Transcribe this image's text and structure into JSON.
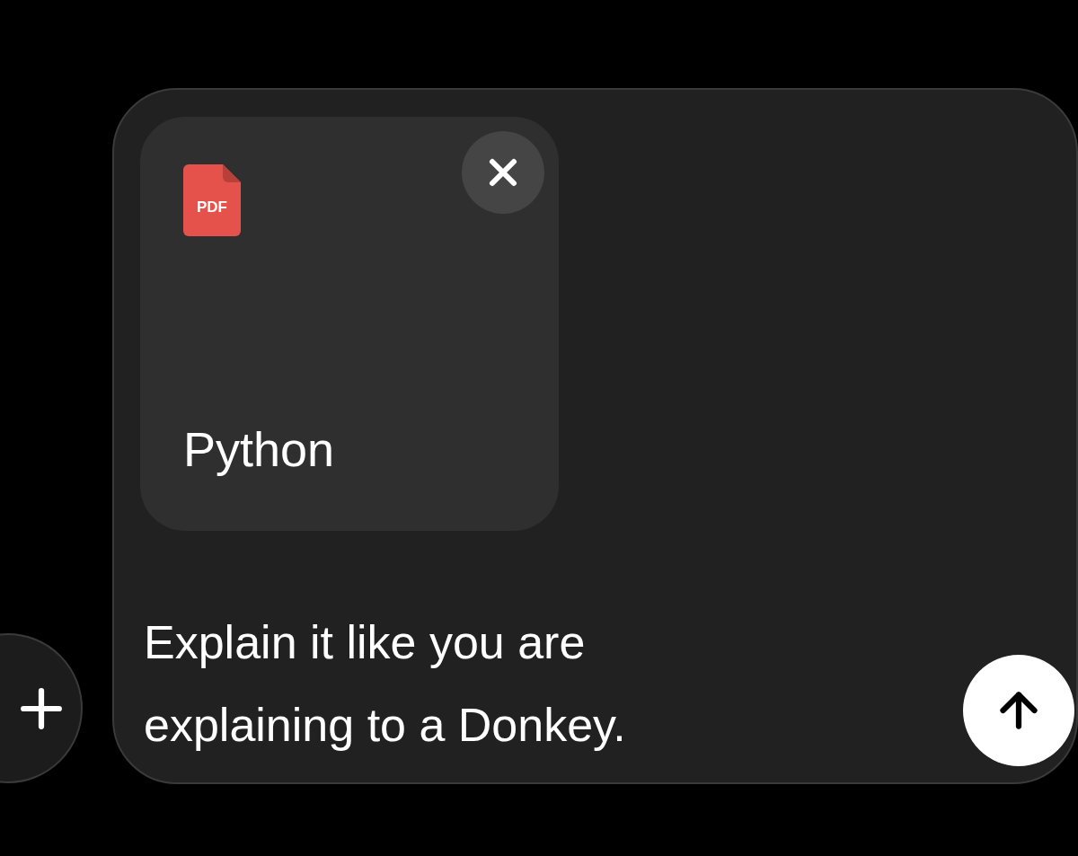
{
  "attachment": {
    "file_type": "PDF",
    "name": "Python"
  },
  "message": {
    "value": "Explain it like you are explaining to a Donkey."
  }
}
